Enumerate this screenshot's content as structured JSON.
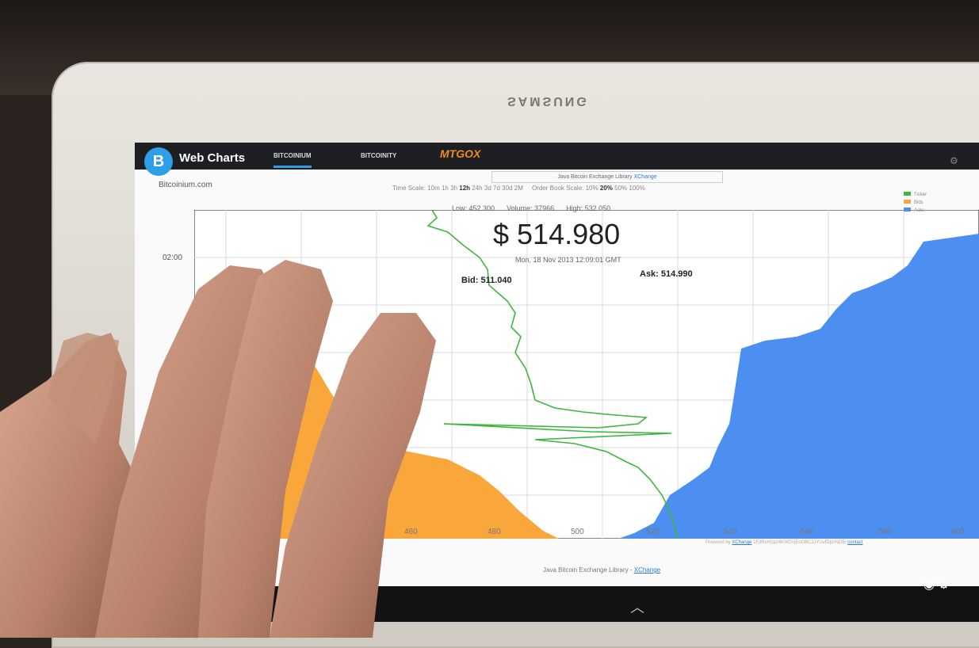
{
  "device": {
    "brand": "SAMSUNG"
  },
  "app": {
    "title": "Web Charts",
    "logo_glyph": "B",
    "tabs": [
      {
        "label": "BITCOINIUM",
        "active": true
      },
      {
        "label": "BITCOINITY",
        "active": false
      },
      {
        "label": "MTGOX",
        "active": false
      }
    ],
    "library_box": {
      "text": "Java Bitcoin Exchange Library",
      "link": "XChange"
    },
    "site": "Bitcoinium.com",
    "time_scale": {
      "label": "Time Scale:",
      "options": [
        "10m",
        "1h",
        "3h",
        "12h",
        "24h",
        "3d",
        "7d",
        "30d",
        "2M"
      ],
      "selected": "12h"
    },
    "order_book_scale": {
      "label": "Order Book Scale:",
      "options": [
        "10%",
        "20%",
        "50%",
        "100%"
      ],
      "selected": "20%"
    }
  },
  "ticker": {
    "low": "Low: 452.300",
    "volume": "Volume: 37966",
    "high": "High: 532.050",
    "price": "$ 514.980",
    "date": "Mon, 18 Nov 2013 12:09:01 GMT",
    "bid": "Bid: 511.040",
    "ask": "Ask: 514.990"
  },
  "chart": {
    "time_axis_label": "02:00",
    "x_ticks": [
      "460",
      "480",
      "500",
      "520",
      "540",
      "560",
      "580",
      "600"
    ],
    "legend": [
      "Ticker",
      "Bids",
      "Asks"
    ],
    "colors": {
      "ticker": "#3fb63f",
      "bids": "#f9a73a",
      "asks": "#4d8ff0"
    }
  },
  "footer": {
    "powered_by": "Powered by",
    "powered_link": "XChange",
    "address": "1FdRoHzpz4KW2VjEoDBCJJYUvfDpnND5r",
    "contact": "contact",
    "library_text": "Java Bitcoin Exchange Library -",
    "library_link": "XChange"
  }
}
